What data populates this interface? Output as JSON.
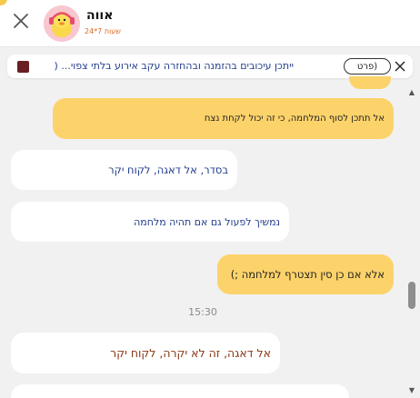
{
  "header": {
    "contact_name": "אווה",
    "contact_sub": "24*7 שעות"
  },
  "notice": {
    "text": "ייתכן עיכובים בהזמנה ובהחזרה עקב אירוע בלתי צפוי... (",
    "details_label": "פרט)"
  },
  "messages": [
    {
      "direction": "out",
      "text": "אל תתכן לסוף המלחמה, כי זה יכול לקחת נצח"
    },
    {
      "direction": "in",
      "text": "בסדר, אל דאגה, לקוח יקר"
    },
    {
      "direction": "in",
      "text": "נמשיך לפעול גם אם תהיה מלחמה"
    },
    {
      "direction": "out",
      "text": "אלא אם כן סין תצטרף למלחמה ;)"
    },
    {
      "direction": "in",
      "text": "אל דאגה, זה לא יקרה, לקוח יקר"
    }
  ],
  "timestamp": "15:30",
  "colors": {
    "outgoing_bubble": "#fcd36a",
    "incoming_text": "#223c8c",
    "accent": "#d66a25"
  }
}
